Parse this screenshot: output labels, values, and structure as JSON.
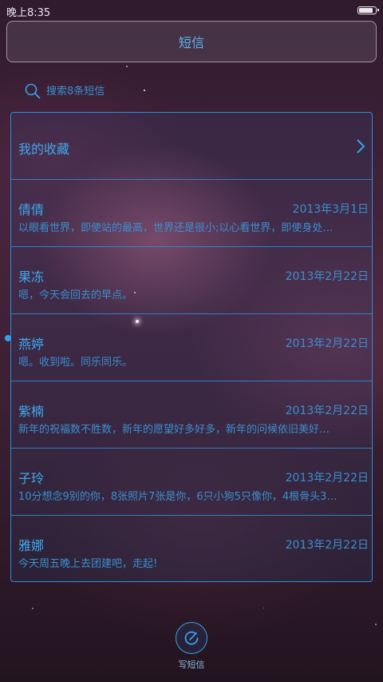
{
  "status_bar": {
    "time": "晚上8:35",
    "battery_level": 0.9
  },
  "header": {
    "title": "短信"
  },
  "search": {
    "placeholder": "搜索8条短信"
  },
  "favorites": {
    "label": "我的收藏",
    "icon": "chevron-right-icon"
  },
  "conversations": [
    {
      "name": "倩倩",
      "date": "2013年3月1日",
      "preview": "以眼看世界，即使站的最高，世界还是很小;以心看世界，即使身处…",
      "unread": false
    },
    {
      "name": "果冻",
      "date": "2013年2月22日",
      "preview": "嗯，今天会回去的早点。",
      "unread": false
    },
    {
      "name": "燕婷",
      "date": "2013年2月22日",
      "preview": "嗯。收到啦。同乐同乐。",
      "unread": true
    },
    {
      "name": "紫楠",
      "date": "2013年2月22日",
      "preview": "新年的祝福数不胜数，新年的愿望好多好多，新年的问候依旧美好…",
      "unread": false
    },
    {
      "name": "子玲",
      "date": "2013年2月22日",
      "preview": "10分想念9别的你，8张照片7张是你，6只小狗5只像你，4根骨头3…",
      "unread": false
    },
    {
      "name": "雅娜",
      "date": "2013年2月22日",
      "preview": "今天周五晚上去团建吧，走起!",
      "unread": false
    }
  ],
  "compose": {
    "label": "写短信",
    "icon": "compose-icon"
  },
  "colors": {
    "accent": "#3ea8ec",
    "border": "#2b8fd8",
    "background": "#3b1f33"
  }
}
